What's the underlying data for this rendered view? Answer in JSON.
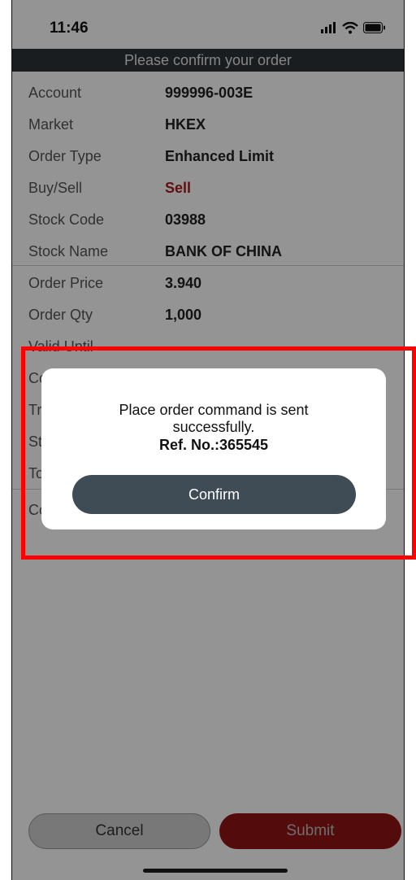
{
  "status_bar": {
    "time": "11:46"
  },
  "header": {
    "title": "Please confirm your order"
  },
  "order": {
    "rows": [
      {
        "label": "Account",
        "value": "999996-003E"
      },
      {
        "label": "Market",
        "value": "HKEX"
      },
      {
        "label": "Order Type",
        "value": "Enhanced Limit"
      },
      {
        "label": "Buy/Sell",
        "value": "Sell"
      },
      {
        "label": "Stock Code",
        "value": "03988"
      },
      {
        "label": "Stock Name",
        "value": "BANK OF CHINA"
      },
      {
        "label": "Order Price",
        "value": "3.940"
      },
      {
        "label": "Order Qty",
        "value": "1,000"
      },
      {
        "label": "Valid Until",
        "value": "---"
      }
    ],
    "partial_labels": [
      "Co",
      "Tr",
      "St",
      "To",
      "Co"
    ]
  },
  "dialog": {
    "message": "Place order command is sent successfully.",
    "ref": "Ref. No.:365545",
    "confirm_label": "Confirm"
  },
  "bottom": {
    "cancel_label": "Cancel",
    "submit_label": "Submit"
  },
  "colors": {
    "sell": "#a51d1d",
    "confirm_button": "#3f4c55",
    "submit_button": "#8f1414",
    "highlight": "#ff0000"
  }
}
